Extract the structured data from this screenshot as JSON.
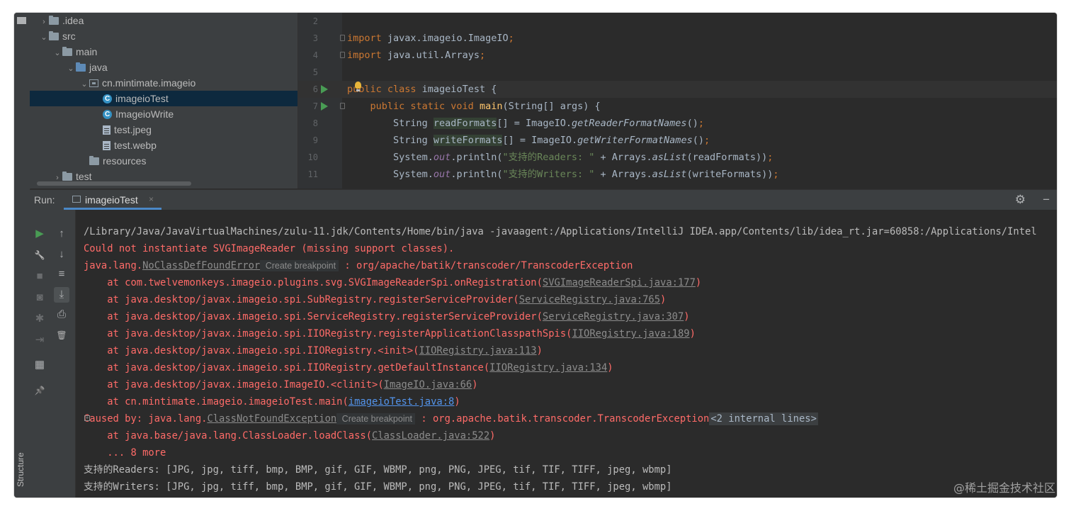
{
  "project_tree": [
    {
      "name": ".idea",
      "icon": "folder-icon",
      "arrow": "›",
      "indent": 1
    },
    {
      "name": "src",
      "icon": "folder-icon",
      "arrow": "⌄",
      "indent": 1
    },
    {
      "name": "main",
      "icon": "folder-icon",
      "arrow": "⌄",
      "indent": 2
    },
    {
      "name": "java",
      "icon": "source-folder-icon",
      "arrow": "⌄",
      "indent": 3
    },
    {
      "name": "cn.mintimate.imageio",
      "icon": "package-icon",
      "arrow": "⌄",
      "indent": 4
    },
    {
      "name": "imageioTest",
      "icon": "java-class-icon",
      "arrow": "",
      "indent": 5,
      "selected": true
    },
    {
      "name": "ImageioWrite",
      "icon": "java-class-icon",
      "arrow": "",
      "indent": 5
    },
    {
      "name": "test.jpeg",
      "icon": "image-file-icon",
      "arrow": "",
      "indent": 5
    },
    {
      "name": "test.webp",
      "icon": "image-file-icon",
      "arrow": "",
      "indent": 5
    },
    {
      "name": "resources",
      "icon": "resources-folder-icon",
      "arrow": "",
      "indent": 4
    },
    {
      "name": "test",
      "icon": "folder-icon",
      "arrow": "›",
      "indent": 2
    }
  ],
  "editor": {
    "line_numbers": [
      "2",
      "3",
      "4",
      "5",
      "6",
      "7",
      "8",
      "9",
      "10",
      "11"
    ],
    "lines": [
      {
        "t": [],
        "run": false,
        "fold": false
      },
      {
        "t": [
          [
            "kw",
            "import "
          ],
          [
            "",
            "javax.imageio.ImageIO"
          ],
          [
            "kw",
            ";"
          ]
        ],
        "run": false,
        "fold": true
      },
      {
        "t": [
          [
            "kw",
            "import "
          ],
          [
            "",
            "java.util.Arrays"
          ],
          [
            "kw",
            ";"
          ]
        ],
        "run": false,
        "fold": true
      },
      {
        "t": [],
        "run": false,
        "fold": false
      },
      {
        "t": [
          [
            "kw",
            "public class "
          ],
          [
            "",
            "imageioTest {"
          ]
        ],
        "run": true,
        "fold": false,
        "current": true
      },
      {
        "t": [
          [
            "",
            "    "
          ],
          [
            "kw",
            "public static void "
          ],
          [
            "fn",
            "main"
          ],
          [
            "",
            "(String[] args) {"
          ]
        ],
        "run": true,
        "fold": true
      },
      {
        "t": [
          [
            "",
            "        String "
          ],
          [
            "hl",
            "readFormats"
          ],
          [
            "",
            "[] = ImageIO."
          ],
          [
            "it",
            "getReaderFormatNames"
          ],
          [
            "",
            "()"
          ],
          [
            "kw",
            ";"
          ]
        ],
        "run": false,
        "fold": false
      },
      {
        "t": [
          [
            "",
            "        String "
          ],
          [
            "hl",
            "writeFormats"
          ],
          [
            "",
            "[] = ImageIO."
          ],
          [
            "it",
            "getWriterFormatNames"
          ],
          [
            "",
            "()"
          ],
          [
            "kw",
            ";"
          ]
        ],
        "run": false,
        "fold": false
      },
      {
        "t": [
          [
            "",
            "        System."
          ],
          [
            "fld",
            "out"
          ],
          [
            "",
            ".println("
          ],
          [
            "st",
            "\"支持的Readers: \""
          ],
          [
            "",
            " + Arrays."
          ],
          [
            "it",
            "asList"
          ],
          [
            "",
            "(readFormats))"
          ],
          [
            "kw",
            ";"
          ]
        ],
        "run": false,
        "fold": false
      },
      {
        "t": [
          [
            "",
            "        System."
          ],
          [
            "fld",
            "out"
          ],
          [
            "",
            ".println("
          ],
          [
            "st",
            "\"支持的Writers: \""
          ],
          [
            "",
            " + Arrays."
          ],
          [
            "it",
            "asList"
          ],
          [
            "",
            "(writeFormats))"
          ],
          [
            "kw",
            ";"
          ]
        ],
        "run": false,
        "fold": false
      }
    ]
  },
  "run_panel": {
    "label": "Run:",
    "tab_name": "imageioTest",
    "close": "×"
  },
  "console": [
    {
      "cls": "normal",
      "parts": [
        [
          "",
          "/Library/Java/JavaVirtualMachines/zulu-11.jdk/Contents/Home/bin/java -javaagent:/Applications/IntelliJ IDEA.app/Contents/lib/idea_rt.jar=60858:/Applications/Intel"
        ]
      ]
    },
    {
      "cls": "",
      "parts": [
        [
          "",
          "Could not instantiate SVGImageReader (missing support classes)."
        ]
      ]
    },
    {
      "cls": "",
      "parts": [
        [
          "",
          "java.lang."
        ],
        [
          "link",
          "NoClassDefFoundError"
        ],
        [
          "hint",
          "Create breakpoint"
        ],
        [
          "",
          " : org/apache/batik/transcoder/TranscoderException"
        ]
      ]
    },
    {
      "cls": "",
      "parts": [
        [
          "",
          "    at com.twelvemonkeys.imageio.plugins.svg.SVGImageReaderSpi.onRegistration("
        ],
        [
          "link",
          "SVGImageReaderSpi.java:177"
        ],
        [
          "",
          ")"
        ]
      ]
    },
    {
      "cls": "",
      "parts": [
        [
          "",
          "    at java.desktop/javax.imageio.spi.SubRegistry.registerServiceProvider("
        ],
        [
          "link",
          "ServiceRegistry.java:765"
        ],
        [
          "",
          ")"
        ]
      ]
    },
    {
      "cls": "",
      "parts": [
        [
          "",
          "    at java.desktop/javax.imageio.spi.ServiceRegistry.registerServiceProvider("
        ],
        [
          "link",
          "ServiceRegistry.java:307"
        ],
        [
          "",
          ")"
        ]
      ]
    },
    {
      "cls": "",
      "parts": [
        [
          "",
          "    at java.desktop/javax.imageio.spi.IIORegistry.registerApplicationClasspathSpis("
        ],
        [
          "link",
          "IIORegistry.java:189"
        ],
        [
          "",
          ")"
        ]
      ]
    },
    {
      "cls": "",
      "parts": [
        [
          "",
          "    at java.desktop/javax.imageio.spi.IIORegistry.<init>("
        ],
        [
          "link",
          "IIORegistry.java:113"
        ],
        [
          "",
          ")"
        ]
      ]
    },
    {
      "cls": "",
      "parts": [
        [
          "",
          "    at java.desktop/javax.imageio.spi.IIORegistry.getDefaultInstance("
        ],
        [
          "link",
          "IIORegistry.java:134"
        ],
        [
          "",
          ")"
        ]
      ]
    },
    {
      "cls": "",
      "parts": [
        [
          "",
          "    at java.desktop/javax.imageio.ImageIO.<clinit>("
        ],
        [
          "link",
          "ImageIO.java:66"
        ],
        [
          "",
          ")"
        ]
      ]
    },
    {
      "cls": "",
      "parts": [
        [
          "",
          "    at cn.mintimate.imageio.imageioTest.main("
        ],
        [
          "link blue",
          "imageioTest.java:8"
        ],
        [
          "",
          ")"
        ]
      ]
    },
    {
      "cls": "",
      "plus": true,
      "parts": [
        [
          "",
          "Caused by: java.lang."
        ],
        [
          "link",
          "ClassNotFoundException"
        ],
        [
          "hint",
          "Create breakpoint"
        ],
        [
          "",
          " : org.apache.batik.transcoder.TranscoderException"
        ],
        [
          "internal",
          "<2 internal lines>"
        ]
      ]
    },
    {
      "cls": "",
      "parts": [
        [
          "",
          "    at java.base/java.lang.ClassLoader.loadClass("
        ],
        [
          "link",
          "ClassLoader.java:522"
        ],
        [
          "",
          ")"
        ]
      ]
    },
    {
      "cls": "",
      "parts": [
        [
          "",
          "    ... 8 more"
        ]
      ]
    },
    {
      "cls": "normal",
      "parts": [
        [
          "",
          "支持的Readers: [JPG, jpg, tiff, bmp, BMP, gif, GIF, WBMP, png, PNG, JPEG, tif, TIF, TIFF, jpeg, wbmp]"
        ]
      ]
    },
    {
      "cls": "normal",
      "parts": [
        [
          "",
          "支持的Writers: [JPG, jpg, tiff, bmp, BMP, gif, GIF, WBMP, png, PNG, JPEG, tif, TIF, TIFF, jpeg, wbmp]"
        ]
      ]
    }
  ],
  "toolbar_icons": [
    {
      "name": "rerun-icon",
      "glyph": "▶",
      "color": "#499c54",
      "col": 0,
      "row": 0
    },
    {
      "name": "wrench-icon",
      "glyph": "🔧",
      "col": 0,
      "row": 1
    },
    {
      "name": "stop-icon",
      "glyph": "■",
      "col": 0,
      "row": 2,
      "dim": true
    },
    {
      "name": "camera-icon",
      "glyph": "◙",
      "col": 0,
      "row": 3,
      "dim": true
    },
    {
      "name": "bug-icon",
      "glyph": "✱",
      "col": 0,
      "row": 4,
      "dim": true
    },
    {
      "name": "exit-icon",
      "glyph": "⇥",
      "col": 0,
      "row": 5,
      "dim": true
    },
    {
      "name": "layout-icon",
      "glyph": "▦",
      "col": 0,
      "row": 6
    },
    {
      "name": "pin-icon",
      "glyph": "📌",
      "col": 0,
      "row": 7
    },
    {
      "name": "up-arrow-icon",
      "glyph": "↑",
      "col": 1,
      "row": 0
    },
    {
      "name": "down-arrow-icon",
      "glyph": "↓",
      "col": 1,
      "row": 1
    },
    {
      "name": "soft-wrap-icon",
      "glyph": "≡",
      "col": 1,
      "row": 2
    },
    {
      "name": "scroll-to-end-icon",
      "glyph": "⤓",
      "col": 1,
      "row": 3,
      "on": true
    },
    {
      "name": "print-icon",
      "glyph": "⎙",
      "col": 1,
      "row": 4
    },
    {
      "name": "trash-icon",
      "glyph": "🗑",
      "col": 1,
      "row": 5
    }
  ],
  "structure_label": "Structure",
  "watermark": "@稀土掘金技术社区",
  "colors": {
    "accent": "#4a88c7",
    "error": "#ff6b68",
    "keyword": "#cc7832",
    "string": "#6a8759",
    "run": "#499c54"
  }
}
